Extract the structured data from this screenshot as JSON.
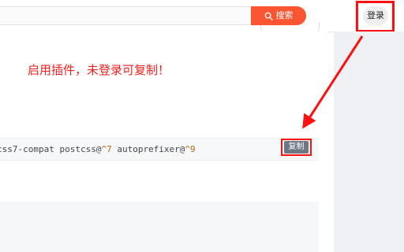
{
  "header": {
    "search_button_label": "搜索",
    "login_label": "登录"
  },
  "annotation": {
    "text": "启用插件，未登录可复制！"
  },
  "code_block": {
    "text_prefix": "css7-compat postcss@",
    "ver1": "^7",
    "text_mid": " autoprefixer@",
    "ver2": "^9",
    "copy_label": "复制"
  },
  "colors": {
    "accent": "#fc5531",
    "annotation_red": "#ee2222",
    "copy_button_bg": "#6e7782",
    "sidebar_bg": "#eef0f4"
  },
  "icons": [
    "search-icon",
    "arrow-annotation"
  ]
}
